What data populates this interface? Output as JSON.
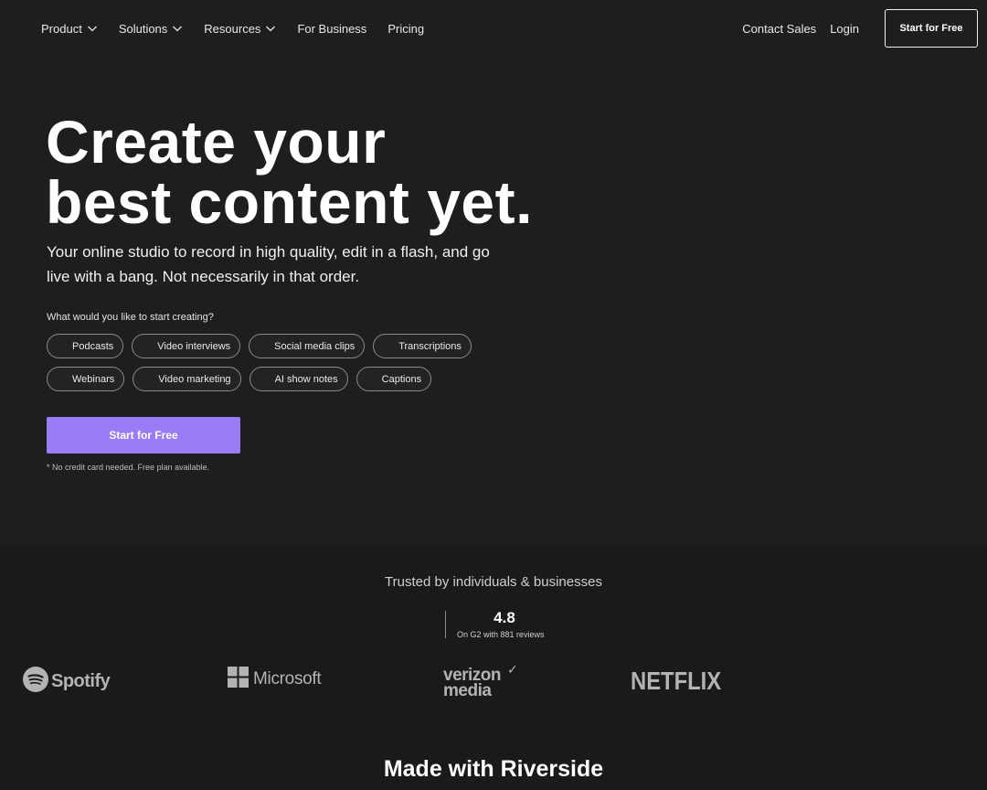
{
  "nav": {
    "items": [
      {
        "label": "Product",
        "has_chevron": true
      },
      {
        "label": "Solutions",
        "has_chevron": true
      },
      {
        "label": "Resources",
        "has_chevron": true
      },
      {
        "label": "For Business",
        "has_chevron": false
      },
      {
        "label": "Pricing",
        "has_chevron": false
      }
    ],
    "contact_sales": "Contact Sales",
    "login": "Login",
    "cta": "Start for Free"
  },
  "hero": {
    "title_line1": "Create your",
    "title_line2": "best content yet.",
    "subtitle": "Your online studio to record in high quality, edit in a flash, and go live with a bang. Not necessarily in that order.",
    "prompt": "What would you like to start creating?",
    "chips_row1": [
      "Podcasts",
      "Video interviews",
      "Social media clips",
      "Transcriptions"
    ],
    "chips_row2": [
      "Webinars",
      "Video marketing",
      "AI show notes",
      "Captions"
    ],
    "cta": "Start for Free",
    "cta_note": "* No credit card needed. Free plan available."
  },
  "trust": {
    "title": "Trusted by individuals & businesses",
    "rating": "4.8",
    "rating_meta": "On G2 with 881 reviews",
    "logos": {
      "spotify": "Spotify",
      "microsoft": "Microsoft",
      "verizon_line1": "verizon",
      "verizon_line2": "media",
      "netflix": "NETFLIX"
    }
  },
  "made_with": "Made with Riverside",
  "colors": {
    "background": "#1e1e1f",
    "accent": "#9a7cf9",
    "logo_gray": "#b3b3b3"
  }
}
